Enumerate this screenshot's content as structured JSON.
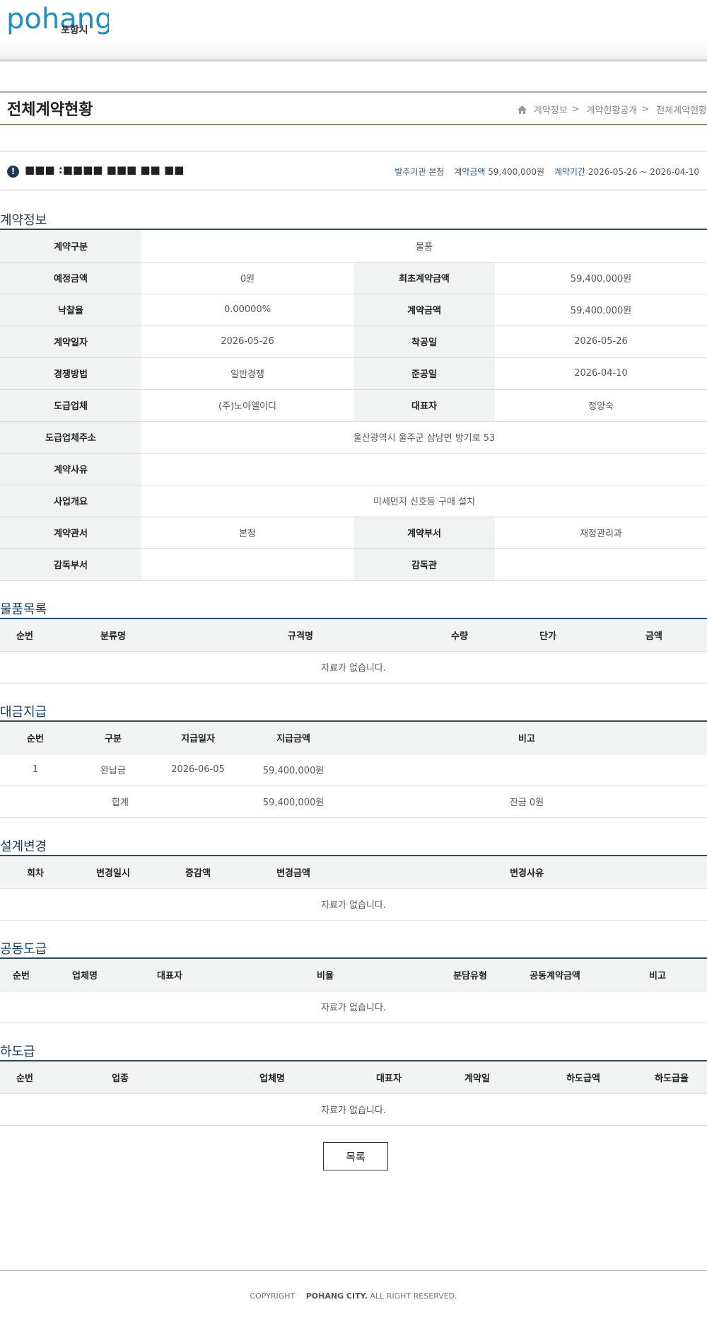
{
  "header": {
    "logo_text": "pohang",
    "logo_sub": "포항시"
  },
  "page": {
    "title": "전체계약현황",
    "breadcrumb": [
      "계약정보",
      "계약현황공개",
      "전체계약현황"
    ],
    "breadcrumb_sep": ">"
  },
  "summary": {
    "name": "■■■ :■■■■ ■■■ ■■ ■■",
    "agency_label": "발주기관",
    "agency": "본청",
    "amount_label": "계약금액",
    "amount": "59,400,000원",
    "period_label": "계약기간",
    "period": "2026-05-26 ~ 2026-04-10"
  },
  "contract_info": {
    "title": "계약정보",
    "labels": {
      "type": "계약구분",
      "est": "예정금액",
      "initial": "최초계약금액",
      "rate": "낙찰율",
      "amount": "계약금액",
      "date": "계약일자",
      "start": "착공일",
      "method": "경쟁방법",
      "end": "준공일",
      "company": "도급업체",
      "ceo": "대표자",
      "address": "도급업체주소",
      "reason": "계약사유",
      "overview": "사업개요",
      "office": "계약관서",
      "dept": "계약부서",
      "sup_dept": "감독부서",
      "supervisor": "감독관"
    },
    "values": {
      "type": "물품",
      "est": "0원",
      "initial": "59,400,000원",
      "rate": "0.00000%",
      "amount": "59,400,000원",
      "date": "2026-05-26",
      "start": "2026-05-26",
      "method": "일반경쟁",
      "end": "2026-04-10",
      "company": "(주)노아엘이디",
      "ceo": "정양숙",
      "address": "울산광역시 울주군 삼남면 방기로 53",
      "reason": "",
      "overview": "미세먼지 신호등 구매 설치",
      "office": "본청",
      "dept": "재정관리과",
      "sup_dept": "",
      "supervisor": ""
    }
  },
  "goods": {
    "title": "물품목록",
    "headers": [
      "순번",
      "분류명",
      "규격명",
      "수량",
      "단가",
      "금액"
    ],
    "empty": "자료가 없습니다."
  },
  "payment": {
    "title": "대금지급",
    "headers": [
      "순번",
      "구분",
      "지급일자",
      "지급금액",
      "비고"
    ],
    "rows": [
      [
        "1",
        "완납금",
        "2026-06-05",
        "59,400,000원",
        ""
      ]
    ],
    "total_label": "합계",
    "total": "59,400,000원",
    "balance": "잔금 0원"
  },
  "design_change": {
    "title": "설계변경",
    "headers": [
      "회차",
      "변경일시",
      "증감액",
      "변경금액",
      "변경사유"
    ],
    "empty": "자료가 없습니다."
  },
  "joint": {
    "title": "공동도급",
    "headers": [
      "순번",
      "업체명",
      "대표자",
      "비율",
      "분담유형",
      "공동계약금액",
      "비고"
    ],
    "empty": "자료가 없습니다."
  },
  "sub": {
    "title": "하도급",
    "headers": [
      "순번",
      "업종",
      "업체명",
      "대표자",
      "계약일",
      "하도급액",
      "하도급율"
    ],
    "empty": "자료가 없습니다."
  },
  "buttons": {
    "list": "목록"
  },
  "footer": {
    "copyright": "COPYRIGHT",
    "org": "POHANG CITY.",
    "rights": "ALL RIGHT RESERVED."
  }
}
